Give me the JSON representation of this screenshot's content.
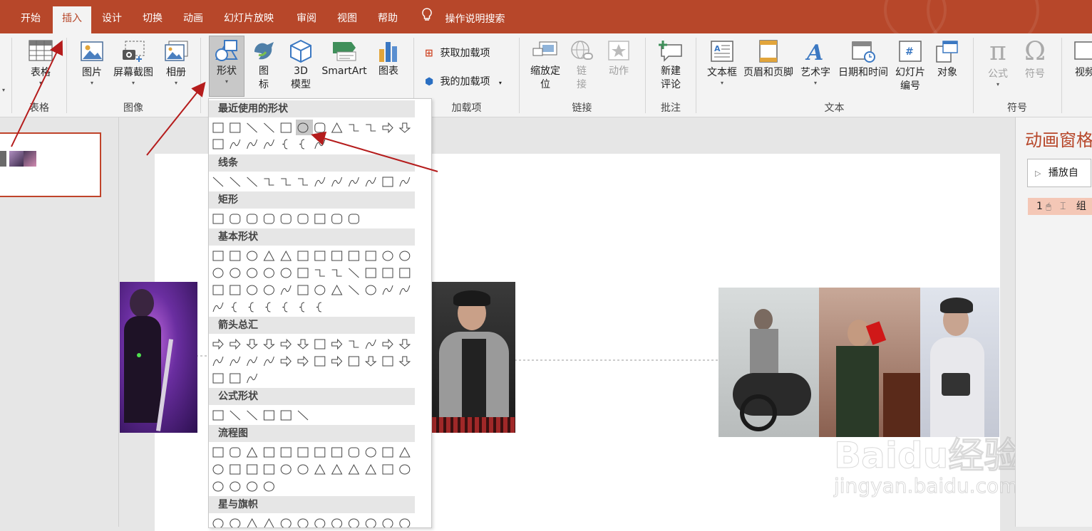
{
  "tabs": [
    {
      "label": "开始",
      "active": false
    },
    {
      "label": "插入",
      "active": true
    },
    {
      "label": "设计",
      "active": false
    },
    {
      "label": "切换",
      "active": false
    },
    {
      "label": "动画",
      "active": false
    },
    {
      "label": "幻灯片放映",
      "active": false
    },
    {
      "label": "审阅",
      "active": false
    },
    {
      "label": "视图",
      "active": false
    },
    {
      "label": "帮助",
      "active": false
    }
  ],
  "tell_me": "操作说明搜索",
  "ribbon": {
    "table": {
      "label": "表格",
      "group": "表格"
    },
    "images": {
      "picture": "图片",
      "screenshot": "屏幕截图",
      "album": "相册",
      "group": "图像"
    },
    "illustrations": {
      "shapes": "形状",
      "icons_1": "图",
      "icons_2": "标",
      "model_1": "3D",
      "model_2": "模型",
      "smartart": "SmartArt",
      "chart": "图表"
    },
    "addins": {
      "get": "获取加载项",
      "mine": "我的加载项",
      "group": "加载项"
    },
    "links": {
      "zoom_1": "缩放定",
      "zoom_2": "位",
      "link_1": "链",
      "link_2": "接",
      "action": "动作",
      "group": "链接"
    },
    "comments": {
      "new_1": "新建",
      "new_2": "评论",
      "group": "批注"
    },
    "text": {
      "textbox": "文本框",
      "header_footer": "页眉和页脚",
      "wordart": "艺术字",
      "datetime": "日期和时间",
      "slide_num_1": "幻灯片",
      "slide_num_2": "编号",
      "object": "对象",
      "group": "文本"
    },
    "symbols": {
      "equation": "公式",
      "symbol": "符号",
      "group": "符号"
    },
    "media": {
      "video": "视频"
    }
  },
  "shapes_gallery": {
    "sections": [
      {
        "title": "最近使用的形状"
      },
      {
        "title": "线条"
      },
      {
        "title": "矩形"
      },
      {
        "title": "基本形状"
      },
      {
        "title": "箭头总汇"
      },
      {
        "title": "公式形状"
      },
      {
        "title": "流程图"
      },
      {
        "title": "星与旗帜"
      }
    ],
    "selected_shape": "oval"
  },
  "animation_pane": {
    "title": "动画窗格",
    "play_button": "播放自",
    "item_number": "1",
    "item_label": "组"
  },
  "watermark": {
    "brand": "Baidu经验",
    "url": "jingyan.baidu.com"
  },
  "colors": {
    "accent": "#b7472a",
    "ribbon_bg": "#f3f3f3",
    "selected_item": "#c8c8c8",
    "anim_item_bg": "#f4c7b6"
  }
}
